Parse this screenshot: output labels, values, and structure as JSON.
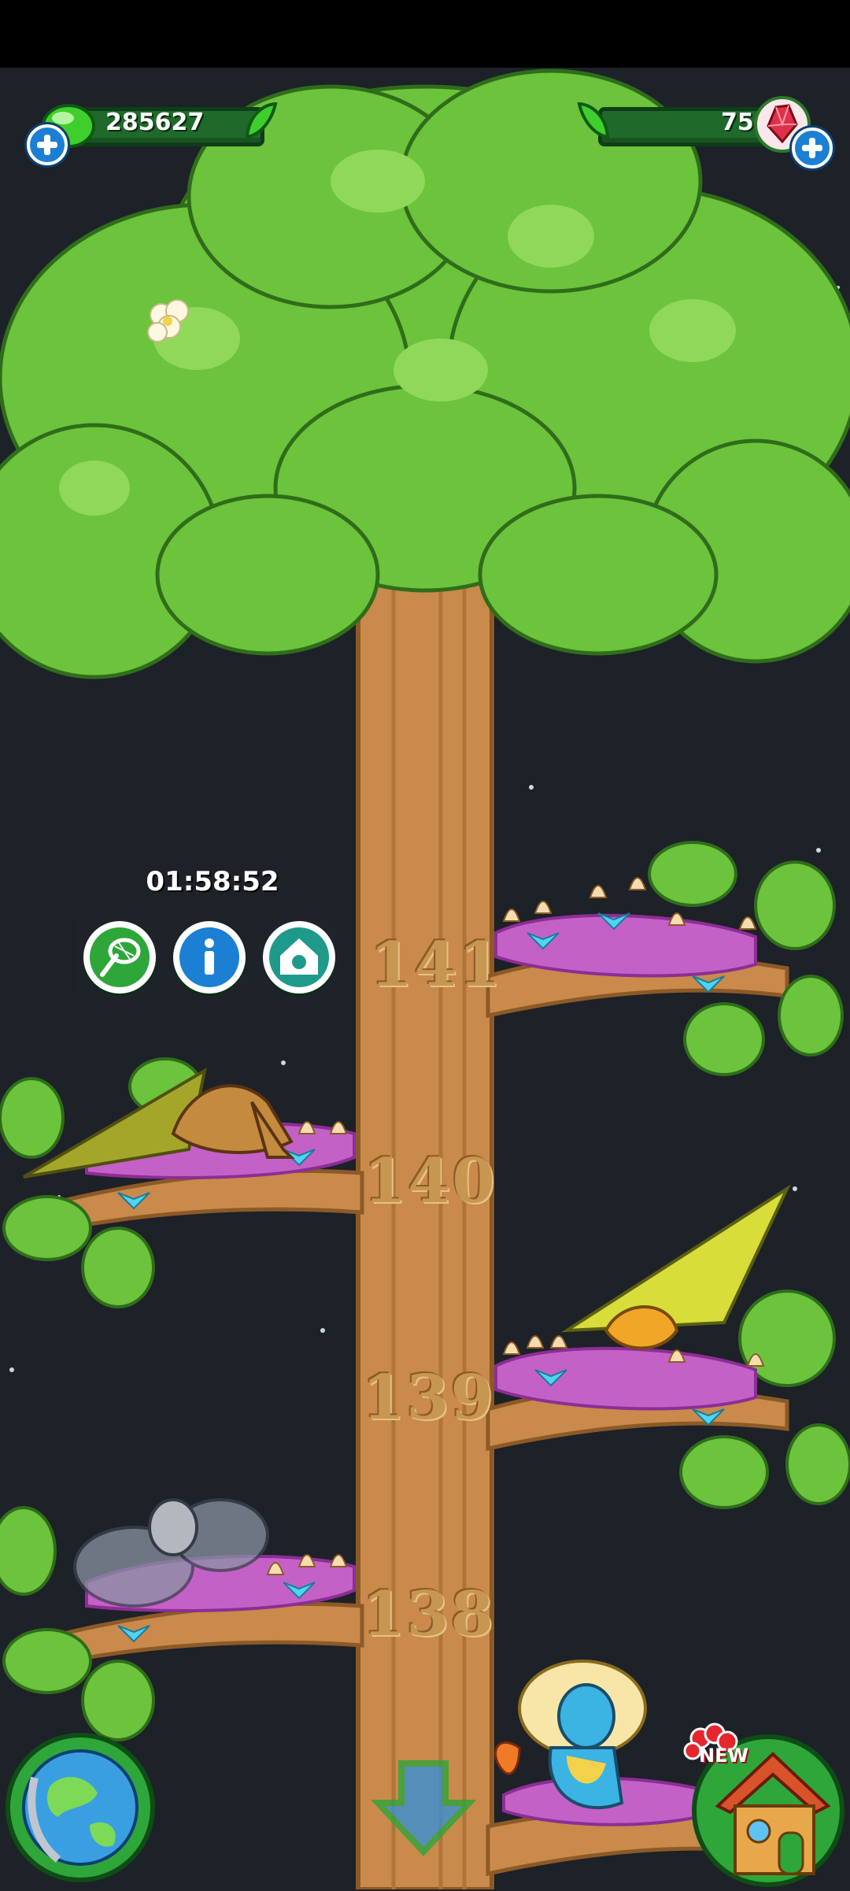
{
  "currency": {
    "green_gems": "285627",
    "red_gems": "75"
  },
  "popup": {
    "timer": "01:58:52",
    "buttons": [
      {
        "icon": "butterfly-net-icon"
      },
      {
        "icon": "info-icon"
      },
      {
        "icon": "animal-house-icon"
      }
    ]
  },
  "levels": [
    "141",
    "140",
    "139",
    "138"
  ],
  "bottom": {
    "new_badge": "NEW"
  },
  "colors": {
    "sky": "#1d2128",
    "leaf": "#6cc33c",
    "trunk": "#c98a4b",
    "currency_bar": "#1f6a2a",
    "plus_button": "#1b7fd4",
    "nest": "#c461c7"
  }
}
